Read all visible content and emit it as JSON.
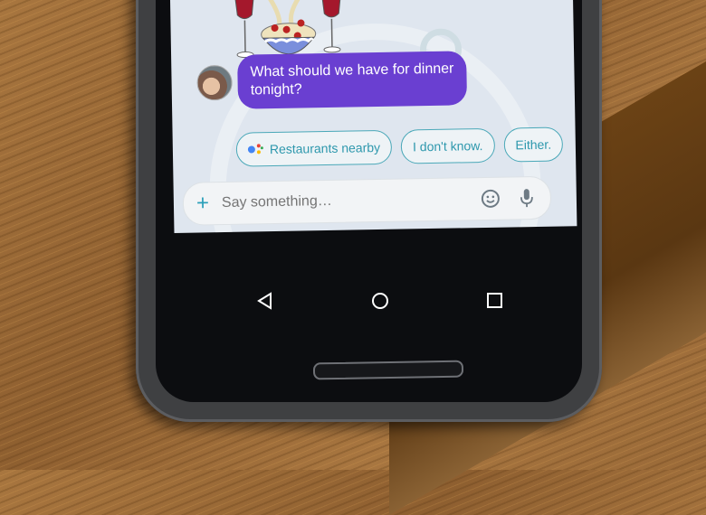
{
  "conversation": {
    "incoming_message": "What should we have for dinner tonight?",
    "sender_avatar": "group-photo-avatar"
  },
  "suggestions": [
    {
      "label": "Restaurants nearby",
      "icon": "google-assistant-icon"
    },
    {
      "label": "I don't know."
    },
    {
      "label": "Either."
    }
  ],
  "composer": {
    "placeholder": "Say something…",
    "value": "",
    "left_icon": "plus-icon",
    "right_icons": [
      "emoji-icon",
      "microphone-icon"
    ]
  },
  "navigation": {
    "buttons": [
      "back",
      "home",
      "recents"
    ]
  },
  "colors": {
    "message_bubble": "#6a3fd1",
    "chip_accent": "#2e98ad",
    "screen_bg": "#dfe6ef"
  }
}
